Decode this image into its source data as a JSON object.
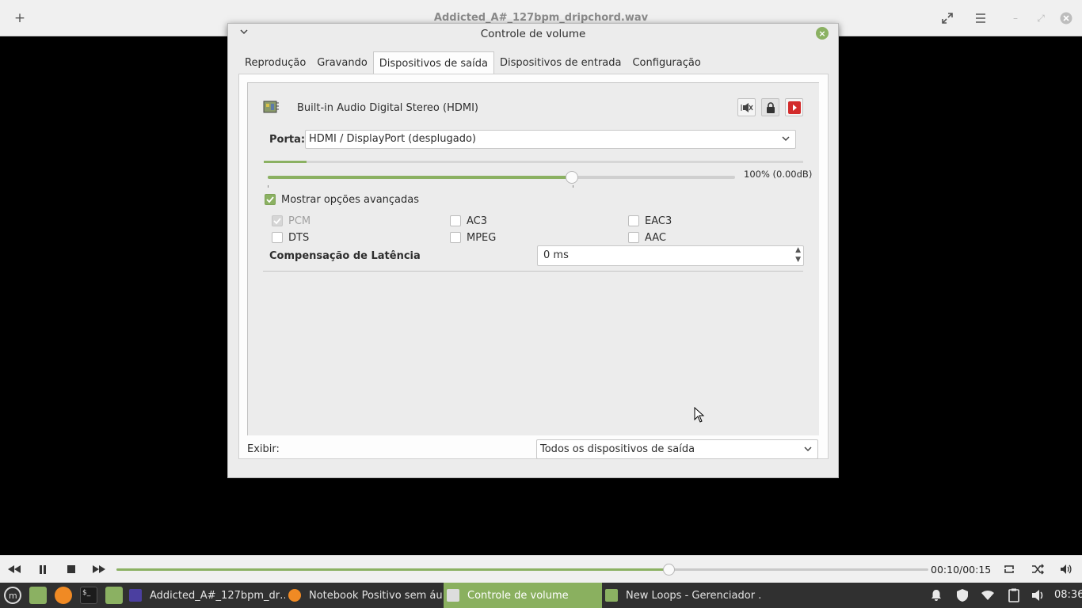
{
  "player": {
    "title": "Addicted_A#_127bpm_dripchord.wav",
    "time": "00:10/00:15",
    "progress": 0.68
  },
  "dialog": {
    "title": "Controle de volume",
    "tabs": [
      {
        "label": "Reprodução",
        "active": false
      },
      {
        "label": "Gravando",
        "active": false
      },
      {
        "label": "Dispositivos de saída",
        "active": true
      },
      {
        "label": "Dispositivos de entrada",
        "active": false
      },
      {
        "label": "Configuração",
        "active": false
      }
    ],
    "device": {
      "name": "Built-in Audio Digital Stereo (HDMI)",
      "port_label": "Porta:",
      "port_value": "HDMI / DisplayPort (desplugado)",
      "meter_level": 0.08,
      "volume_level": 0.65,
      "volume_text": "100% (0.00dB)",
      "advanced_label": "Mostrar opções avançadas",
      "advanced_checked": true,
      "formats": [
        {
          "label": "PCM",
          "checked": true,
          "disabled": true
        },
        {
          "label": "AC3",
          "checked": false,
          "disabled": false
        },
        {
          "label": "EAC3",
          "checked": false,
          "disabled": false
        },
        {
          "label": "DTS",
          "checked": false,
          "disabled": false
        },
        {
          "label": "MPEG",
          "checked": false,
          "disabled": false
        },
        {
          "label": "AAC",
          "checked": false,
          "disabled": false
        }
      ],
      "latency_label": "Compensação de Latência",
      "latency_value": "0 ms"
    },
    "show_label": "Exibir:",
    "show_value": "Todos os dispositivos de saída"
  },
  "taskbar": {
    "tasks": [
      {
        "label": "Addicted_A#_127bpm_dr…",
        "active": false
      },
      {
        "label": "Notebook Positivo sem áu…",
        "active": false
      },
      {
        "label": "Controle de volume",
        "active": true
      },
      {
        "label": "New Loops - Gerenciador …",
        "active": false
      }
    ],
    "clock": "08:36"
  },
  "colors": {
    "accent": "#8bb162",
    "taskbar": "#303030",
    "video": "#000000"
  }
}
